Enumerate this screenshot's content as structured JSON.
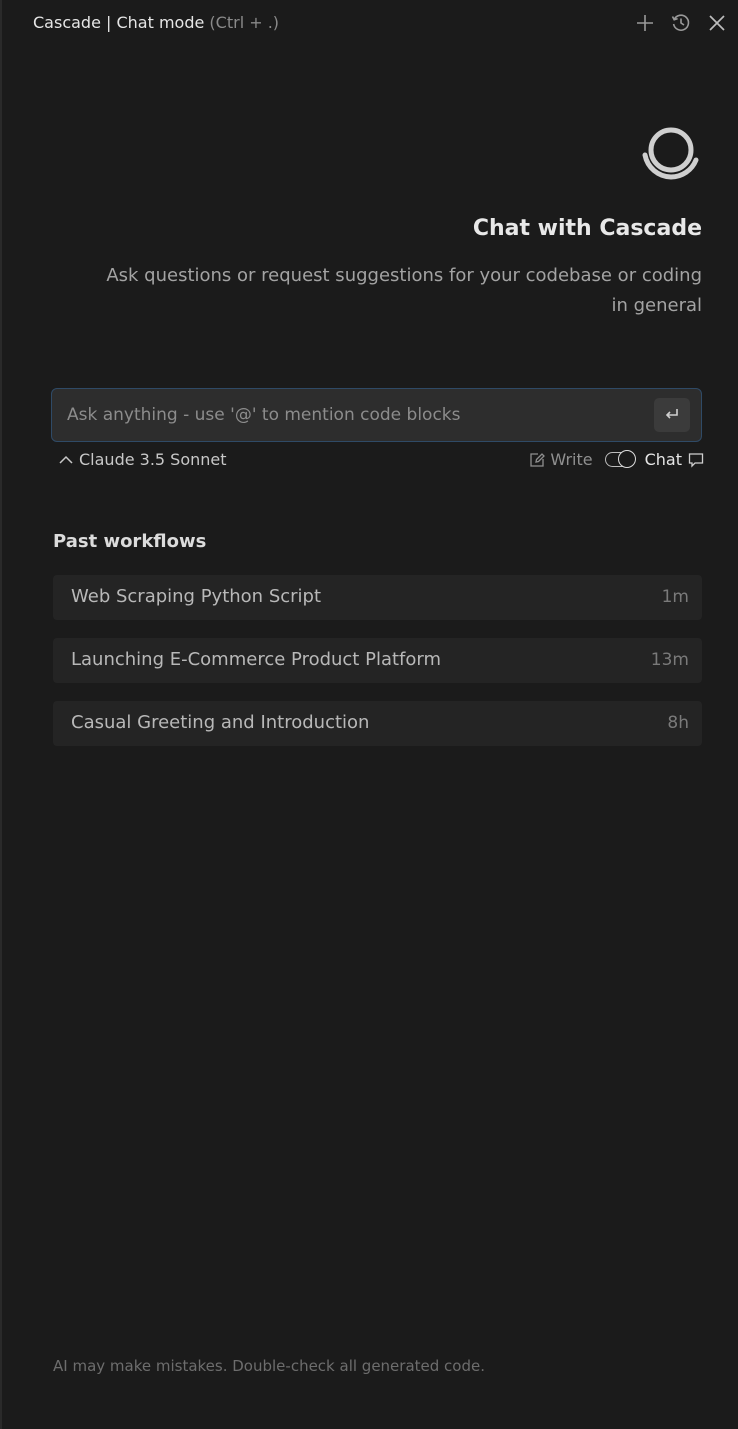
{
  "header": {
    "title_main": "Cascade | Chat mode",
    "title_hint": "(Ctrl + .)",
    "actions": [
      {
        "name": "new-chat",
        "icon": "plus-icon"
      },
      {
        "name": "history",
        "icon": "history-icon"
      },
      {
        "name": "close",
        "icon": "close-icon"
      }
    ]
  },
  "hero": {
    "title": "Chat with Cascade",
    "subtitle": "Ask questions or request suggestions for your codebase or coding in general"
  },
  "input": {
    "placeholder": "Ask anything - use '@' to mention code blocks",
    "value": ""
  },
  "controls": {
    "model": "Claude 3.5 Sonnet",
    "write_label": "Write",
    "chat_label": "Chat",
    "active_mode": "Chat"
  },
  "past_workflows": {
    "title": "Past workflows",
    "items": [
      {
        "title": "Web Scraping Python Script",
        "time": "1m"
      },
      {
        "title": "Launching E-Commerce Product Platform",
        "time": "13m"
      },
      {
        "title": "Casual Greeting and Introduction",
        "time": "8h"
      }
    ]
  },
  "footer": {
    "disclaimer": "AI may make mistakes. Double-check all generated code."
  },
  "colors": {
    "background": "#1b1b1b",
    "input_border": "#2f4a66",
    "item_background": "#242424"
  }
}
